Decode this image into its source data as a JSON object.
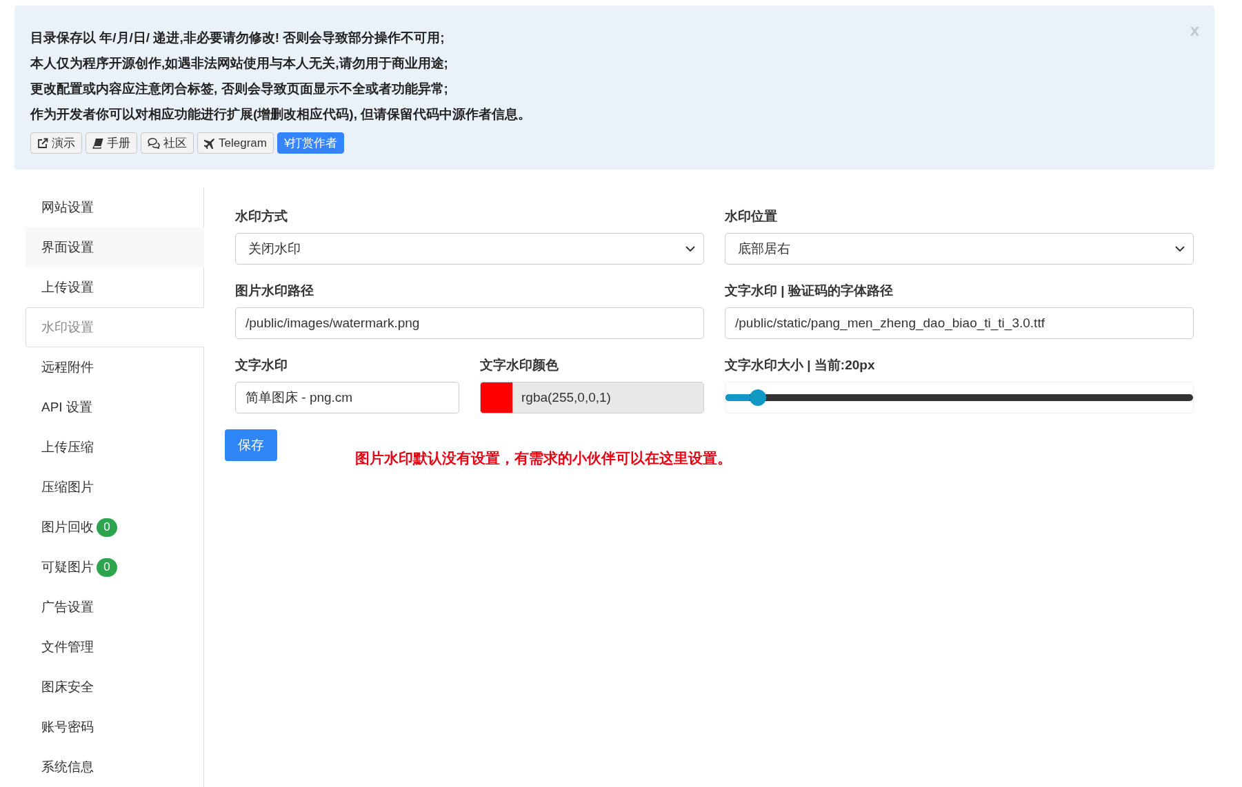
{
  "notice": {
    "lines": [
      "目录保存以 年/月/日/ 递进,非必要请勿修改! 否则会导致部分操作不可用;",
      "本人仅为程序开源创作,如遇非法网站使用与本人无关,请勿用于商业用途;",
      "更改配置或内容应注意闭合标签, 否则会导致页面显示不全或者功能异常;",
      "作为开发者你可以对相应功能进行扩展(增删改相应代码), 但请保留代码中源作者信息。"
    ],
    "buttons": [
      {
        "label": "演示",
        "kind": "default"
      },
      {
        "label": "手册",
        "kind": "default"
      },
      {
        "label": "社区",
        "kind": "default"
      },
      {
        "label": "Telegram",
        "kind": "default"
      },
      {
        "label": "¥打赏作者",
        "kind": "primary"
      }
    ],
    "close": "x"
  },
  "sidebar": {
    "items": [
      {
        "label": "网站设置",
        "selected": false,
        "hovered": false
      },
      {
        "label": "界面设置",
        "selected": false,
        "hovered": true
      },
      {
        "label": "上传设置",
        "selected": false,
        "hovered": false
      },
      {
        "label": "水印设置",
        "selected": true,
        "hovered": false
      },
      {
        "label": "远程附件",
        "selected": false,
        "hovered": false
      },
      {
        "label": "API 设置",
        "selected": false,
        "hovered": false
      },
      {
        "label": "上传压缩",
        "selected": false,
        "hovered": false
      },
      {
        "label": "压缩图片",
        "selected": false,
        "hovered": false
      },
      {
        "label": "图片回收",
        "selected": false,
        "hovered": false,
        "badge": "0"
      },
      {
        "label": "可疑图片",
        "selected": false,
        "hovered": false,
        "badge": "0"
      },
      {
        "label": "广告设置",
        "selected": false,
        "hovered": false
      },
      {
        "label": "文件管理",
        "selected": false,
        "hovered": false
      },
      {
        "label": "图床安全",
        "selected": false,
        "hovered": false
      },
      {
        "label": "账号密码",
        "selected": false,
        "hovered": false
      },
      {
        "label": "系统信息",
        "selected": false,
        "hovered": false
      }
    ]
  },
  "form": {
    "rows": [
      [
        {
          "kind": "select",
          "label": "水印方式",
          "value": "关闭水印"
        },
        {
          "kind": "select",
          "label": "水印位置",
          "value": "底部居右"
        }
      ],
      [
        {
          "kind": "text",
          "label": "图片水印路径",
          "value": "/public/images/watermark.png"
        },
        {
          "kind": "text",
          "label": "文字水印 | 验证码的字体路径",
          "value": "/public/static/pang_men_zheng_dao_biao_ti_ti_3.0.ttf"
        }
      ],
      [
        {
          "kind": "text",
          "label": "文字水印",
          "value": "简单图床 - png.cm"
        },
        {
          "kind": "color",
          "label": "文字水印颜色",
          "value": "rgba(255,0,0,1)",
          "color": "#ff0000"
        },
        {
          "kind": "slider",
          "label": "文字水印大小 | 当前:20px",
          "level": 0.07
        }
      ]
    ],
    "save_button": "保存",
    "note": "图片水印默认没有设置，有需求的小伙伴可以在这里设置。"
  }
}
